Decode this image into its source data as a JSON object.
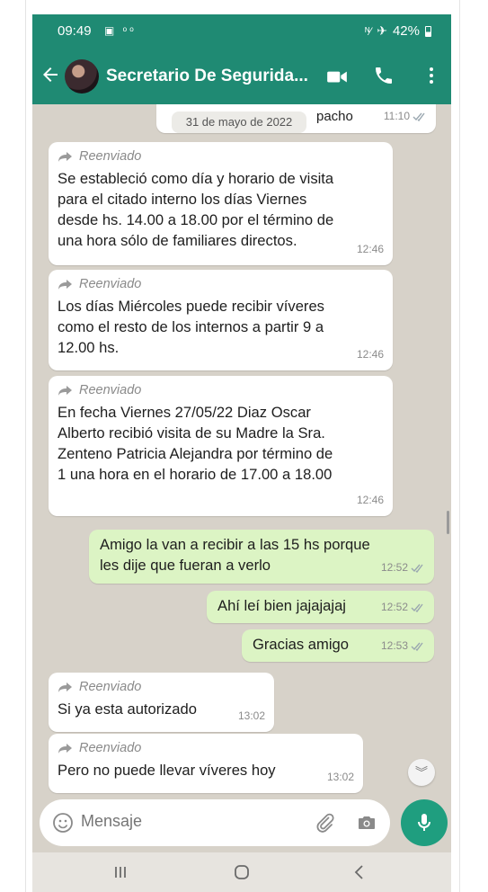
{
  "status_bar": {
    "time": "09:49",
    "battery": "42%"
  },
  "header": {
    "contact_name": "Secretario De Segurida..."
  },
  "date_pill": "31 de mayo de 2022",
  "top_partial": {
    "text": "pacho",
    "time": "11:10"
  },
  "messages": [
    {
      "forwarded_label": "Reenviado",
      "text": "Se estableció como día y horario de visita\npara el citado interno los días Viernes\ndesde hs. 14.00 a 18.00 por el término de\nuna hora sólo de familiares directos.",
      "time": "12:46"
    },
    {
      "forwarded_label": "Reenviado",
      "text": "Los días Miércoles puede recibir víveres\ncomo el resto de los internos a partir 9 a\n12.00 hs.",
      "time": "12:46"
    },
    {
      "forwarded_label": "Reenviado",
      "text": "En fecha Viernes 27/05/22 Diaz  Oscar\nAlberto recibió visita de su Madre la Sra.\nZenteno Patricia Alejandra por término de\n1 una hora en el horario de 17.00 a 18.00",
      "time": "12:46"
    },
    {
      "text": "Amigo la van a recibir a las 15 hs porque\nles dije que fueran a verlo",
      "time": "12:52"
    },
    {
      "text": "Ahí leí bien jajajajaj",
      "time": "12:52"
    },
    {
      "text": "Gracias amigo",
      "time": "12:53"
    },
    {
      "forwarded_label": "Reenviado",
      "text": "Si ya esta autorizado",
      "time": "13:02"
    },
    {
      "forwarded_label": "Reenviado",
      "text": "Pero no puede llevar víveres hoy",
      "time": "13:02"
    }
  ],
  "composer": {
    "placeholder": "Mensaje"
  },
  "colors": {
    "header": "#1f8a73",
    "outgoing_bubble": "#dcf4c4",
    "incoming_bubble": "#ffffff",
    "chat_background": "#d7d2c9",
    "mic_button": "#1f9e7f"
  }
}
